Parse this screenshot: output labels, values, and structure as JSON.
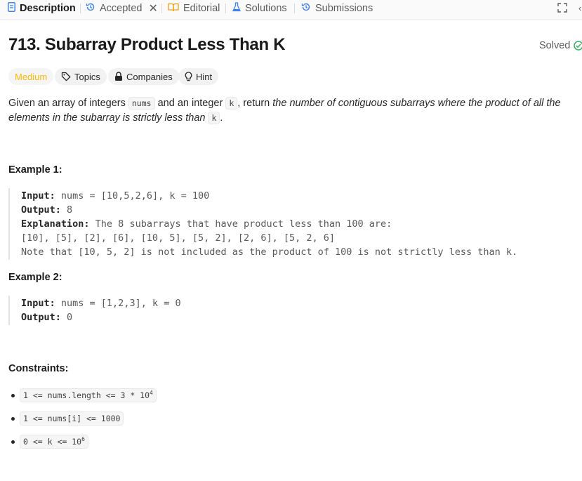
{
  "tabs": [
    {
      "label": "Description",
      "icon": "document-icon",
      "active": true
    },
    {
      "label": "Accepted",
      "icon": "history-icon",
      "closable": true
    },
    {
      "label": "Editorial",
      "icon": "book-icon"
    },
    {
      "label": "Solutions",
      "icon": "flask-icon"
    },
    {
      "label": "Submissions",
      "icon": "history-icon"
    }
  ],
  "problem": {
    "title": "713. Subarray Product Less Than K",
    "status": "Solved",
    "difficulty": "Medium",
    "tags": [
      "Topics",
      "Companies",
      "Hint"
    ]
  },
  "description": {
    "p1": "Given an array of integers ",
    "code_nums": "nums",
    "p2": " and an integer ",
    "code_k": "k",
    "p3": ", return ",
    "italic": "the number of contiguous subarrays where the product of all the elements in the subarray is strictly less than",
    "p4": " ",
    "code_k2": "k",
    "p5": "."
  },
  "examples": [
    {
      "heading": "Example 1:",
      "input_label": "Input:",
      "input": " nums = [10,5,2,6], k = 100",
      "output_label": "Output:",
      "output": " 8",
      "explanation_label": "Explanation:",
      "explanation": " The 8 subarrays that have product less than 100 are:",
      "explanation_line2": "[10], [5], [2], [6], [10, 5], [5, 2], [2, 6], [5, 2, 6]",
      "explanation_line3": "Note that [10, 5, 2] is not included as the product of 100 is not strictly less than k."
    },
    {
      "heading": "Example 2:",
      "input_label": "Input:",
      "input": " nums = [1,2,3], k = 0",
      "output_label": "Output:",
      "output": " 0"
    }
  ],
  "constraints": {
    "heading": "Constraints:",
    "items": [
      {
        "text": "1 <= nums.length <= 3 * 10",
        "sup": "4"
      },
      {
        "text": "1 <= nums[i] <= 1000",
        "sup": ""
      },
      {
        "text": "0 <= k <= 10",
        "sup": "6"
      }
    ]
  },
  "colors": {
    "medium": "#ffb800",
    "solved_check": "#2db55d"
  }
}
